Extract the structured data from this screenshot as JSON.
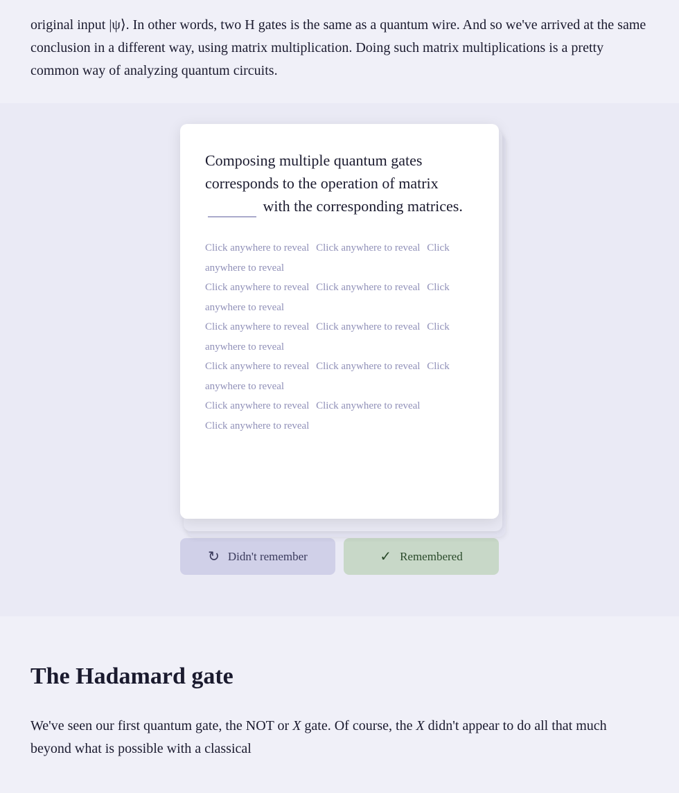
{
  "intro": {
    "paragraph": "original input |ψ⟩. In other words, two H gates is the same as a quantum wire. And so we've arrived at the same conclusion in a different way, using matrix multiplication. Doing such matrix multiplications is a pretty common way of analyzing quantum circuits."
  },
  "flashcard": {
    "question_part1": "Composing multiple quantum gates corresponds to the operation of matrix",
    "question_blank": "______",
    "question_part2": "with the corresponding matrices.",
    "reveal_lines": [
      "Click anywhere to reveal",
      "Click anywhere to reveal",
      "Click anywhere to reveal",
      "Click anywhere to reveal",
      "Click anywhere to reveal",
      "Click anywhere to reveal",
      "Click anywhere to reveal",
      "Click anywhere to reveal",
      "Click anywhere to reveal",
      "Click anywhere to reveal",
      "Click anywhere to reveal",
      "Click anywhere to reveal",
      "Click anywhere to reveal",
      "Click anywhere to reveal",
      "Click anywhere to reveal"
    ]
  },
  "buttons": {
    "didnt_remember": "Didn't remember",
    "remembered": "Remembered"
  },
  "hadamard": {
    "heading": "The Hadamard gate",
    "paragraph1": "We've seen our first quantum gate, the NOT or",
    "math_x1": "X",
    "paragraph2": "gate. Of course, the",
    "math_x2": "X",
    "paragraph3": "didn't appear to do all that much beyond what is possible with a classical"
  }
}
